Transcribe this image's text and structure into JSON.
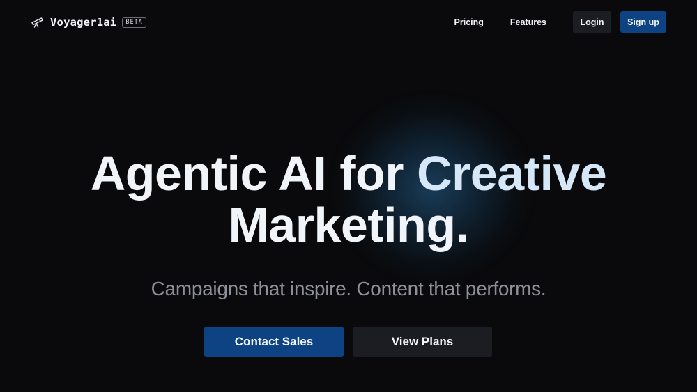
{
  "header": {
    "brand_name": "Voyager1ai",
    "beta_badge": "BETA",
    "logo_icon": "telescope-icon",
    "nav": {
      "pricing_label": "Pricing",
      "features_label": "Features",
      "login_label": "Login",
      "signup_label": "Sign up"
    }
  },
  "hero": {
    "title_part1": "Agentic AI for ",
    "title_accent": "Creative",
    "title_line2": "Marketing.",
    "subtitle": "Campaigns that inspire. Content that performs.",
    "primary_cta": "Contact Sales",
    "secondary_cta": "View Plans"
  },
  "colors": {
    "background": "#0a0a0c",
    "primary_button": "#0d4283",
    "secondary_button": "#1b1d22",
    "glow": "#1c4666",
    "title_accent": "#d6e8f7"
  }
}
